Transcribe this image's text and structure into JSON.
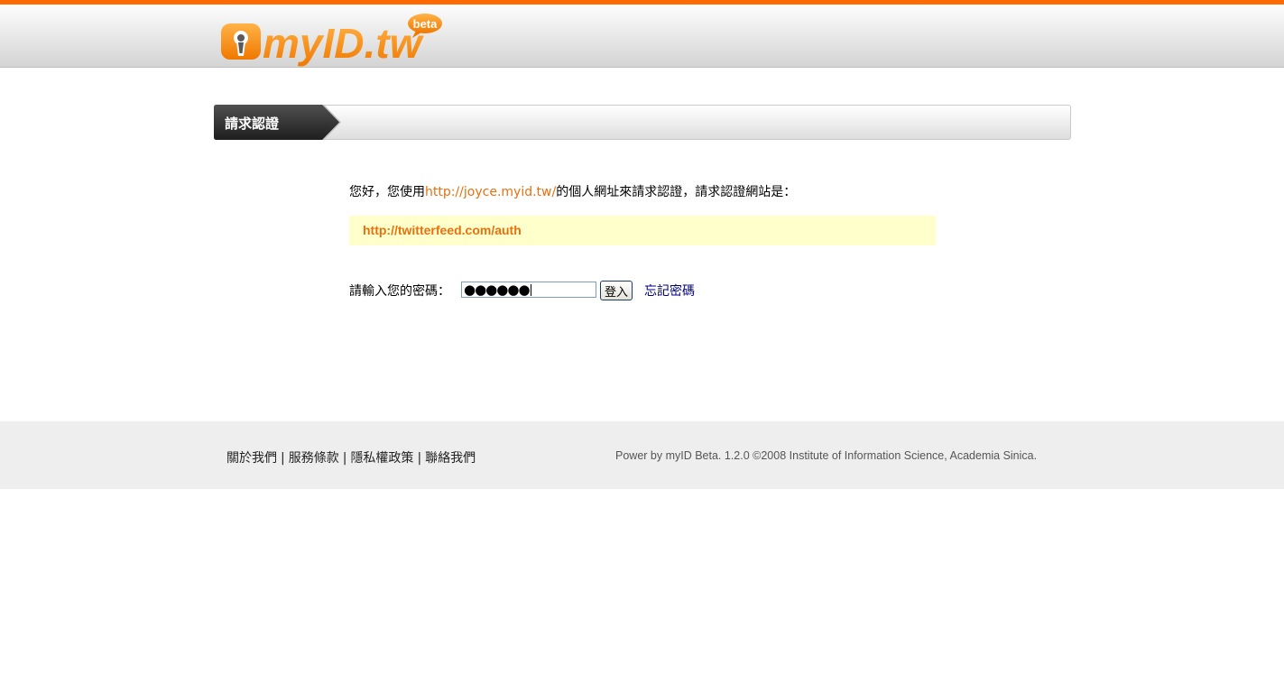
{
  "header": {
    "logo_text": "myID.tw",
    "logo_badge": "beta"
  },
  "title_bar": {
    "title": "請求認證"
  },
  "intro": {
    "prefix": "您好，您使用",
    "user_url": "http://joyce.myid.tw/",
    "suffix": "的個人網址來請求認證，請求認證網站是："
  },
  "auth_site": {
    "url": "http://twitterfeed.com/auth"
  },
  "login_form": {
    "password_label": "請輸入您的密碼：",
    "password_value": "●●●●●●",
    "submit_label": "登入",
    "forgot_label": "忘記密碼"
  },
  "footer": {
    "links": [
      "關於我們",
      "服務條款",
      "隱私權政策",
      "聯絡我們"
    ],
    "separator": "|",
    "copyright": "Power by myID Beta. 1.2.0 ©2008 Institute of Information Science, Academia Sinica."
  },
  "colors": {
    "accent": "#ff6a00",
    "link_orange": "#e8700f",
    "highlight_bg": "#ffffcc",
    "footer_bg": "#eeeeee"
  }
}
